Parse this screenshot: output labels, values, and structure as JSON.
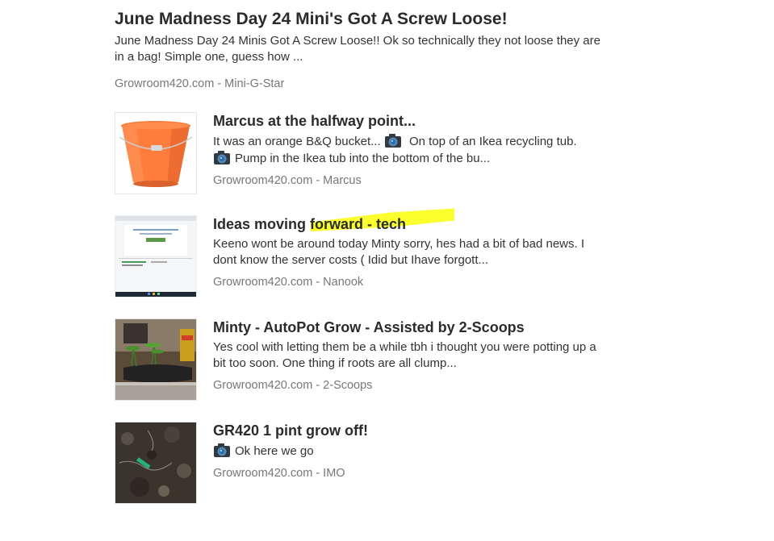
{
  "feed": {
    "top_item": {
      "title": "June Madness Day 24 Mini's Got A Screw Loose!",
      "snippet": "June Madness Day 24 Minis Got A Screw Loose!! Ok so technically they not loose they are in a bag! Simple one, guess how ...",
      "source": "Growroom420.com - Mini-G-Star"
    },
    "items": [
      {
        "title": "Marcus at the halfway point...",
        "snippet_part1": "It was an orange B&Q bucket...",
        "snippet_part2": "On top of an Ikea recycling tub.",
        "snippet_part3": "Pump in the Ikea tub into the bottom of the bu...",
        "source": "Growroom420.com - Marcus",
        "thumb_icon": "orange-bucket-image"
      },
      {
        "title": "Ideas moving forward - tech",
        "snippet": "Keeno wont be around today Minty sorry, hes had a bit of bad news. I dont know the server costs ( Idid but Ihave forgott...",
        "source": "Growroom420.com - Nanook",
        "thumb_icon": "screenshot-image",
        "highlight_color": "#fbff2d"
      },
      {
        "title": "Minty - AutoPot Grow - Assisted by 2-Scoops",
        "snippet": "Yes cool with letting them be a while tbh i thought you were potting up a bit too soon. One thing if roots are all clump...",
        "source": "Growroom420.com - 2-Scoops",
        "thumb_icon": "plants-photo"
      },
      {
        "title": "GR420 1 pint grow off!",
        "snippet": "Ok here we go",
        "source": "Growroom420.com - IMO",
        "thumb_icon": "soil-photo"
      }
    ],
    "camera_icon": "camera-icon"
  }
}
